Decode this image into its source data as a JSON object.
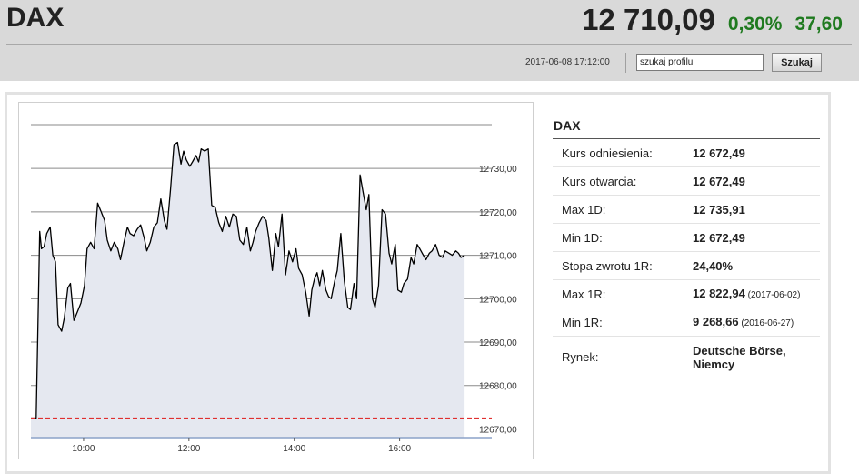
{
  "header": {
    "name": "DAX",
    "price": "12 710,09",
    "change_pct": "0,30%",
    "change_abs": "37,60",
    "datetime": "2017-06-08 17:12:00",
    "search_value": "szukaj profilu",
    "search_button": "Szukaj"
  },
  "colors": {
    "header_bg": "#d9d9d9",
    "positive": "#1f7a1f",
    "series_line": "#000000",
    "series_fill": "#e5e8f0",
    "reference_line": "#e03030",
    "grid": "#8a8a8a"
  },
  "info": {
    "title": "DAX",
    "rows": [
      {
        "label": "Kurs odniesienia:",
        "value": "12 672,49",
        "date": ""
      },
      {
        "label": "Kurs otwarcia:",
        "value": "12 672,49",
        "date": ""
      },
      {
        "label": "Max 1D:",
        "value": "12 735,91",
        "date": ""
      },
      {
        "label": "Min 1D:",
        "value": "12 672,49",
        "date": ""
      },
      {
        "label": "Stopa zwrotu 1R:",
        "value": "24,40%",
        "date": ""
      },
      {
        "label": "Max 1R:",
        "value": "12 822,94",
        "date": "(2017-06-02)"
      },
      {
        "label": "Min 1R:",
        "value": "9 268,66",
        "date": "(2016-06-27)"
      },
      {
        "label": "Rynek:",
        "value": "Deutsche Börse, Niemcy",
        "date": ""
      }
    ]
  },
  "chart_data": {
    "type": "area",
    "x_unit": "time of day",
    "x_ticks": [
      "10:00",
      "12:00",
      "14:00",
      "16:00"
    ],
    "y_ticks": [
      "12730,00",
      "12720,00",
      "12710,00",
      "12700,00",
      "12690,00",
      "12680,00",
      "12670,00"
    ],
    "ylim": [
      12668,
      12738
    ],
    "xlim": [
      "09:00",
      "17:45"
    ],
    "reference_value": 12672.49,
    "grid": true,
    "x": [
      "09:00",
      "09:06",
      "09:10",
      "09:12",
      "09:15",
      "09:18",
      "09:22",
      "09:25",
      "09:28",
      "09:31",
      "09:35",
      "09:38",
      "09:42",
      "09:45",
      "09:49",
      "09:53",
      "09:57",
      "10:01",
      "10:04",
      "10:08",
      "10:12",
      "10:16",
      "10:20",
      "10:24",
      "10:27",
      "10:31",
      "10:35",
      "10:39",
      "10:42",
      "10:46",
      "10:50",
      "10:53",
      "10:57",
      "11:01",
      "11:05",
      "11:09",
      "11:12",
      "11:16",
      "11:20",
      "11:24",
      "11:28",
      "11:32",
      "11:35",
      "11:39",
      "11:43",
      "11:47",
      "11:51",
      "11:54",
      "11:57",
      "12:01",
      "12:04",
      "12:08",
      "12:11",
      "12:14",
      "12:18",
      "12:22",
      "12:26",
      "12:30",
      "12:34",
      "12:38",
      "12:42",
      "12:46",
      "12:50",
      "12:54",
      "12:58",
      "13:02",
      "13:06",
      "13:10",
      "13:13",
      "13:16",
      "13:20",
      "13:24",
      "13:28",
      "13:31",
      "13:35",
      "13:39",
      "13:42",
      "13:46",
      "13:50",
      "13:54",
      "13:58",
      "14:02",
      "14:05",
      "14:09",
      "14:13",
      "14:17",
      "14:20",
      "14:23",
      "14:26",
      "14:29",
      "14:32",
      "14:36",
      "14:39",
      "14:42",
      "14:46",
      "14:49",
      "14:53",
      "14:57",
      "15:01",
      "15:04",
      "15:08",
      "15:11",
      "15:15",
      "15:18",
      "15:22",
      "15:25",
      "15:29",
      "15:32",
      "15:36",
      "15:40",
      "15:44",
      "15:48",
      "15:51",
      "15:55",
      "15:58",
      "16:02",
      "16:05",
      "16:09",
      "16:13",
      "16:16",
      "16:20",
      "16:23",
      "16:27",
      "16:30",
      "16:34",
      "16:37",
      "16:41",
      "16:45",
      "16:49",
      "16:52",
      "16:56",
      "17:00",
      "17:04",
      "17:07",
      "17:10",
      "17:14"
    ],
    "series": [
      {
        "values": [
          12672.5,
          12672.5,
          12715.5,
          12711.5,
          12712.0,
          12715.0,
          12716.5,
          12710.0,
          12708.5,
          12694.0,
          12692.5,
          12695.5,
          12702.5,
          12703.5,
          12695.0,
          12697.0,
          12699.0,
          12703.0,
          12711.5,
          12713.0,
          12711.5,
          12722.0,
          12720.0,
          12718.0,
          12713.5,
          12711.0,
          12713.0,
          12711.5,
          12709.0,
          12713.0,
          12716.5,
          12715.0,
          12714.5,
          12716.0,
          12717.0,
          12714.0,
          12711.0,
          12713.0,
          12716.5,
          12717.5,
          12723.0,
          12718.0,
          12716.0,
          12725.0,
          12735.5,
          12736.0,
          12731.0,
          12734.0,
          12732.0,
          12730.5,
          12731.5,
          12733.0,
          12731.5,
          12734.5,
          12734.0,
          12734.5,
          12721.5,
          12721.0,
          12717.5,
          12715.5,
          12719.0,
          12716.5,
          12719.5,
          12719.0,
          12713.5,
          12712.5,
          12716.5,
          12711.0,
          12713.0,
          12715.5,
          12717.5,
          12719.0,
          12718.0,
          12714.0,
          12706.5,
          12715.0,
          12712.0,
          12719.5,
          12705.5,
          12711.0,
          12708.5,
          12711.5,
          12707.0,
          12705.5,
          12701.5,
          12696.0,
          12702.0,
          12704.5,
          12706.0,
          12703.0,
          12706.5,
          12702.0,
          12700.5,
          12700.0,
          12704.0,
          12706.5,
          12715.0,
          12704.0,
          12698.0,
          12697.5,
          12703.5,
          12700.0,
          12728.5,
          12725.0,
          12720.5,
          12724.0,
          12700.0,
          12698.0,
          12703.0,
          12720.5,
          12719.5,
          12710.5,
          12708.0,
          12712.5,
          12702.0,
          12701.5,
          12703.5,
          12704.5,
          12709.5,
          12708.0,
          12712.5,
          12711.5,
          12710.0,
          12709.0,
          12710.5,
          12711.0,
          12712.5,
          12710.0,
          12709.5,
          12711.0,
          12710.5,
          12710.0,
          12711.0,
          12710.5,
          12709.5,
          12710.0
        ]
      }
    ]
  }
}
